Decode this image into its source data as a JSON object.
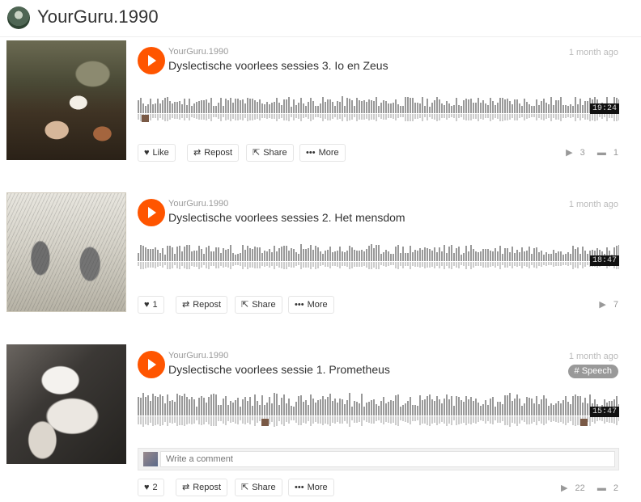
{
  "header": {
    "title": "YourGuru.1990"
  },
  "tracks": [
    {
      "uploader": "YourGuru.1990",
      "title": "Dyslectische voorlees sessies 3. Io en Zeus",
      "posted": "1 month ago",
      "duration": "19:24",
      "actions": {
        "like": "Like",
        "repost": "Repost",
        "share": "Share",
        "more": "More"
      },
      "stats": {
        "plays": "3",
        "comments": "1"
      }
    },
    {
      "uploader": "YourGuru.1990",
      "title": "Dyslectische voorlees sessies 2. Het mensdom",
      "posted": "1 month ago",
      "duration": "18:47",
      "actions": {
        "like": "1",
        "repost": "Repost",
        "share": "Share",
        "more": "More"
      },
      "stats": {
        "plays": "7"
      }
    },
    {
      "uploader": "YourGuru.1990",
      "title": "Dyslectische voorlees sessie 1. Prometheus",
      "posted": "1 month ago",
      "tag": "# Speech",
      "duration": "15:47",
      "comment_placeholder": "Write a comment",
      "actions": {
        "like": "2",
        "repost": "Repost",
        "share": "Share",
        "more": "More"
      },
      "stats": {
        "plays": "22",
        "comments": "2"
      }
    }
  ],
  "icons": {
    "play": "play-icon",
    "like": "heart-icon",
    "repost": "repost-icon",
    "share": "share-icon",
    "more": "more-icon",
    "plays": "play-count-icon",
    "comments": "comment-icon"
  },
  "colors": {
    "accent": "#ff5500",
    "waveform": "#999999",
    "tag": "#999999"
  }
}
